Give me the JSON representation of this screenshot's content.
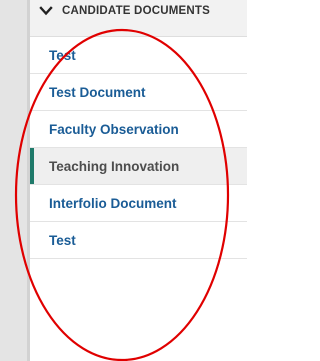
{
  "section": {
    "title": "CANDIDATE DOCUMENTS",
    "chevron_icon": "chevron-down-icon"
  },
  "documents": [
    {
      "label": "Test",
      "selected": false
    },
    {
      "label": "Test Document",
      "selected": false
    },
    {
      "label": "Faculty Observation",
      "selected": false
    },
    {
      "label": "Teaching Innovation",
      "selected": true
    },
    {
      "label": "Interfolio Document",
      "selected": false
    },
    {
      "label": "Test",
      "selected": false
    }
  ],
  "colors": {
    "link": "#1a5c96",
    "selected_indicator": "#1f7a6a",
    "selected_background": "#efefef",
    "annotation": "#e00000"
  }
}
